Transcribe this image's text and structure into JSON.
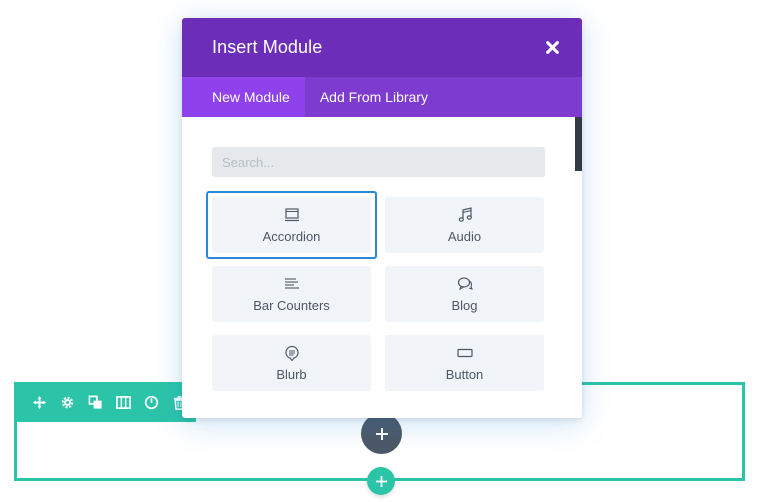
{
  "modal": {
    "title": "Insert Module",
    "tabs": [
      {
        "label": "New Module",
        "active": true
      },
      {
        "label": "Add From Library",
        "active": false
      }
    ],
    "search": {
      "placeholder": "Search...",
      "value": ""
    },
    "modules": [
      {
        "label": "Accordion",
        "icon": "accordion-icon",
        "selected": true
      },
      {
        "label": "Audio",
        "icon": "music-note-icon",
        "selected": false
      },
      {
        "label": "Bar Counters",
        "icon": "bars-icon",
        "selected": false
      },
      {
        "label": "Blog",
        "icon": "chat-bubbles-icon",
        "selected": false
      },
      {
        "label": "Blurb",
        "icon": "blurb-icon",
        "selected": false
      },
      {
        "label": "Button",
        "icon": "button-icon",
        "selected": false
      }
    ]
  },
  "row_toolbar": {
    "icons": [
      "move-icon",
      "gear-icon",
      "duplicate-icon",
      "columns-icon",
      "power-icon",
      "trash-icon"
    ]
  },
  "colors": {
    "header": "#6c2eb9",
    "tabs": "#7e3bd0",
    "active_tab": "#8f42ec",
    "row_accent": "#2cc4a8",
    "selection": "#2b87da",
    "dark_button": "#4c5866"
  }
}
